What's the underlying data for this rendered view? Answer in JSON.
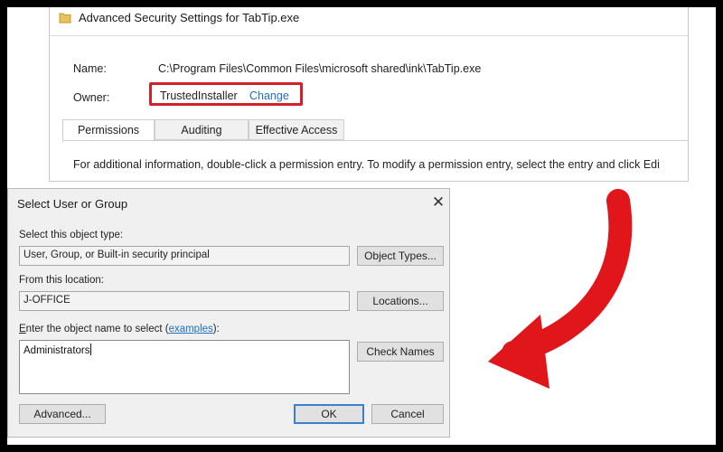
{
  "advanced_security": {
    "title": "Advanced Security Settings for TabTip.exe",
    "name_label": "Name:",
    "name_value": "C:\\Program Files\\Common Files\\microsoft shared\\ink\\TabTip.exe",
    "owner_label": "Owner:",
    "owner_value": "TrustedInstaller",
    "owner_change_link": "Change",
    "tabs": [
      {
        "label": "Permissions",
        "selected": true
      },
      {
        "label": "Auditing",
        "selected": false
      },
      {
        "label": "Effective Access",
        "selected": false
      }
    ],
    "info_text": "For additional information, double-click a permission entry. To modify a permission entry, select the entry and click Edi"
  },
  "select_user_dialog": {
    "title": "Select User or Group",
    "close_glyph": "✕",
    "object_type_label": "Select this object type:",
    "object_type_value": "User, Group, or Built-in security principal",
    "object_types_button": "Object Types...",
    "location_label": "From this location:",
    "location_value": "J-OFFICE",
    "locations_button": "Locations...",
    "enter_name_label_prefix_ul": "E",
    "enter_name_label_rest": "nter the object name to select (",
    "examples_link": "examples",
    "enter_name_label_suffix": "):",
    "object_name_value": "Administrators",
    "check_names_button": "Check Names",
    "advanced_button": "Advanced...",
    "ok_button": "OK",
    "cancel_button": "Cancel"
  },
  "colors": {
    "highlight_red": "#d4202a",
    "arrow_red": "#e0161b",
    "link_blue": "#1f6fc4",
    "dialog_bg": "#f0f0f0"
  },
  "icons": {
    "title_icon": "folder-icon",
    "close": "close-icon",
    "annotation": "curved-arrow-icon"
  }
}
